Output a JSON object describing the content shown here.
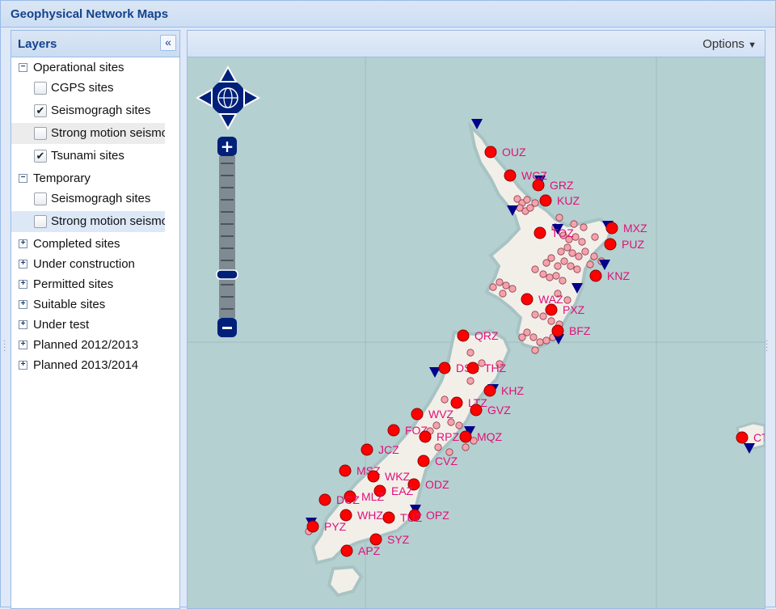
{
  "app": {
    "title": "Geophysical Network Maps"
  },
  "layers_panel": {
    "title": "Layers",
    "collapse_icon": "double-chevron-left-icon",
    "groups": [
      {
        "label": "Operational sites",
        "expanded": true,
        "children": [
          {
            "label": "CGPS sites",
            "checked": false
          },
          {
            "label": "Seismogragh sites",
            "checked": true
          },
          {
            "label": "Strong motion seismographs",
            "checked": false
          },
          {
            "label": "Tsunami sites",
            "checked": true
          }
        ]
      },
      {
        "label": "Temporary",
        "expanded": true,
        "children": [
          {
            "label": "Seismogragh sites",
            "checked": false
          },
          {
            "label": "Strong motion seismographs",
            "checked": false
          }
        ]
      },
      {
        "label": "Completed sites",
        "expanded": false
      },
      {
        "label": "Under construction",
        "expanded": false
      },
      {
        "label": "Permitted sites",
        "expanded": false
      },
      {
        "label": "Suitable sites",
        "expanded": false
      },
      {
        "label": "Under test",
        "expanded": false
      },
      {
        "label": "Planned 2012/2013",
        "expanded": false
      },
      {
        "label": "Planned 2013/2014",
        "expanded": false
      }
    ]
  },
  "map_panel": {
    "options_label": "Options",
    "options_icon": "caret-down-icon",
    "colors": {
      "sea": "#b5d0d0",
      "land": "#f2efe9",
      "site": "#ff0000",
      "label": "#e0107a",
      "tsunami": "#00008b",
      "control": "#00207a"
    },
    "sites": [
      {
        "code": "OUZ"
      },
      {
        "code": "WCZ"
      },
      {
        "code": "GRZ"
      },
      {
        "code": "KUZ"
      },
      {
        "code": "MXZ"
      },
      {
        "code": "TOZ"
      },
      {
        "code": "PUZ"
      },
      {
        "code": "KNZ"
      },
      {
        "code": "WAZ"
      },
      {
        "code": "PXZ"
      },
      {
        "code": "BFZ"
      },
      {
        "code": "QRZ"
      },
      {
        "code": "DSZ"
      },
      {
        "code": "THZ"
      },
      {
        "code": "KHZ"
      },
      {
        "code": "LTZ"
      },
      {
        "code": "WVZ"
      },
      {
        "code": "GVZ"
      },
      {
        "code": "FOZ"
      },
      {
        "code": "RPZ"
      },
      {
        "code": "MQZ"
      },
      {
        "code": "JCZ"
      },
      {
        "code": "CVZ"
      },
      {
        "code": "MSZ"
      },
      {
        "code": "WKZ"
      },
      {
        "code": "ODZ"
      },
      {
        "code": "EAZ"
      },
      {
        "code": "MLZ"
      },
      {
        "code": "DCZ"
      },
      {
        "code": "WHZ"
      },
      {
        "code": "OPZ"
      },
      {
        "code": "TUZ"
      },
      {
        "code": "PYZ"
      },
      {
        "code": "SYZ"
      },
      {
        "code": "APZ"
      },
      {
        "code": "CTZ"
      }
    ]
  }
}
